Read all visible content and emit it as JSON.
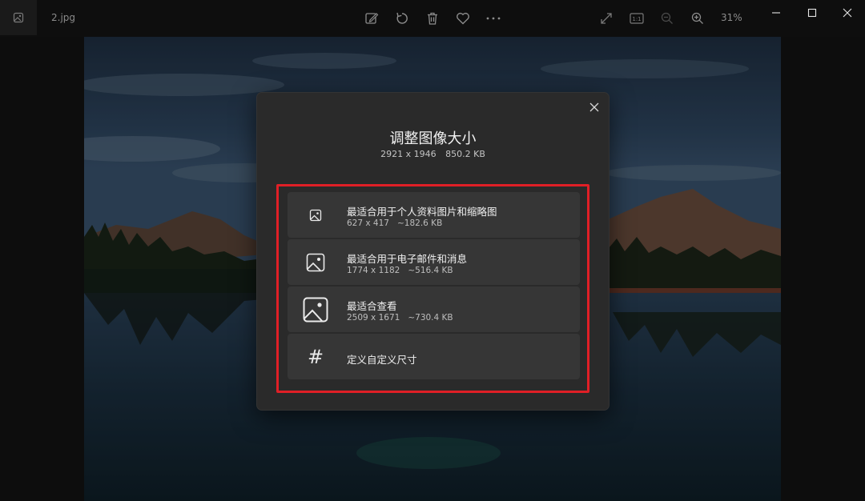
{
  "window": {
    "filename": "2.jpg",
    "zoom_level": "31%"
  },
  "toolbar": {
    "icons": [
      "edit-image-icon",
      "rotate-icon",
      "delete-icon",
      "favorite-icon",
      "more-icon"
    ],
    "right_icons": [
      "full-screen-icon",
      "actual-size-icon",
      "zoom-out-icon",
      "zoom-in-icon"
    ],
    "actual_size_label": "1:1"
  },
  "dialog": {
    "title": "调整图像大小",
    "dimensions": "2921 x 1946",
    "file_size": "850.2 KB",
    "options": [
      {
        "label": "最适合用于个人资料图片和缩略图",
        "dimensions": "627 x 417",
        "size": "~182.6 KB",
        "icon": "small-image-icon"
      },
      {
        "label": "最适合用于电子邮件和消息",
        "dimensions": "1774 x 1182",
        "size": "~516.4 KB",
        "icon": "medium-image-icon"
      },
      {
        "label": "最适合查看",
        "dimensions": "2509 x 1671",
        "size": "~730.4 KB",
        "icon": "large-image-icon"
      },
      {
        "label": "定义自定义尺寸",
        "icon": "hash-icon",
        "glyph": "#"
      }
    ],
    "highlight_color": "#e01f26"
  }
}
